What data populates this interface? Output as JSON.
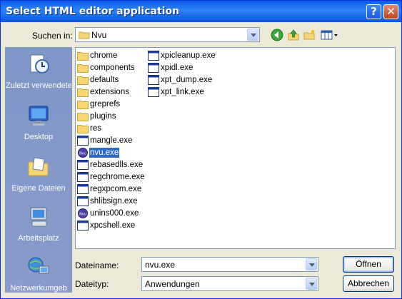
{
  "window": {
    "title": "Select HTML editor application",
    "help_label": "?",
    "close_label": "✕"
  },
  "lookin": {
    "label": "Suchen in:",
    "value": "Nvu",
    "icons": [
      "back-icon",
      "up-folder-icon",
      "new-folder-icon",
      "view-menu-icon"
    ]
  },
  "places": [
    {
      "label": "Zuletzt verwendete D...",
      "icon": "recent-documents-icon"
    },
    {
      "label": "Desktop",
      "icon": "desktop-icon"
    },
    {
      "label": "Eigene Dateien",
      "icon": "my-documents-icon"
    },
    {
      "label": "Arbeitsplatz",
      "icon": "my-computer-icon"
    },
    {
      "label": "Netzwerkumgeb",
      "icon": "network-icon"
    }
  ],
  "files_col1": [
    {
      "name": "chrome",
      "type": "folder"
    },
    {
      "name": "components",
      "type": "folder"
    },
    {
      "name": "defaults",
      "type": "folder"
    },
    {
      "name": "extensions",
      "type": "folder"
    },
    {
      "name": "greprefs",
      "type": "folder"
    },
    {
      "name": "plugins",
      "type": "folder"
    },
    {
      "name": "res",
      "type": "folder"
    },
    {
      "name": "mangle.exe",
      "type": "exe"
    },
    {
      "name": "nvu.exe",
      "type": "nvu",
      "selected": true
    },
    {
      "name": "rebasedlls.exe",
      "type": "exe"
    },
    {
      "name": "regchrome.exe",
      "type": "exe"
    },
    {
      "name": "regxpcom.exe",
      "type": "exe"
    },
    {
      "name": "shlibsign.exe",
      "type": "exe"
    },
    {
      "name": "unins000.exe",
      "type": "nvu"
    },
    {
      "name": "xpcshell.exe",
      "type": "exe"
    }
  ],
  "files_col2": [
    {
      "name": "xpicleanup.exe",
      "type": "exe"
    },
    {
      "name": "xpidl.exe",
      "type": "exe"
    },
    {
      "name": "xpt_dump.exe",
      "type": "exe"
    },
    {
      "name": "xpt_link.exe",
      "type": "exe"
    }
  ],
  "filename": {
    "label": "Dateiname:",
    "value": "nvu.exe"
  },
  "filetype": {
    "label": "Dateityp:",
    "value": "Anwendungen"
  },
  "buttons": {
    "open": "Öffnen",
    "cancel": "Abbrechen"
  }
}
